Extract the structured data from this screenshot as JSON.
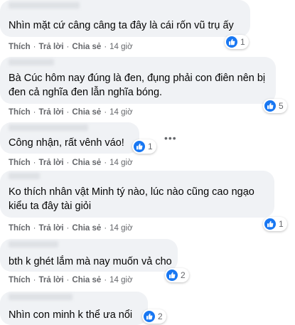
{
  "actions": {
    "like": "Thích",
    "reply": "Trả lời",
    "share": "Chia sẻ",
    "separator": "·"
  },
  "icons": {
    "like": "like-icon",
    "more": "more-options-icon"
  },
  "colors": {
    "like_blue": "#1877f2",
    "bubble": "#f0f2f5",
    "muted_text": "#65676b"
  },
  "comments": [
    {
      "text": "Nhìn mặt cứ câng câng ta đây là cái rốn vũ trụ ấy",
      "time": "14 giờ",
      "reactions": "1"
    },
    {
      "text": "Bà Cúc hôm nay đúng là đen, đụng phải con điên nên bị\nđen cả nghĩa đen lẫn nghĩa bóng.",
      "time": "14 giờ",
      "reactions": "5"
    },
    {
      "text": "Công nhận, rất vênh váo!",
      "time": "14 giờ",
      "reactions": "1"
    },
    {
      "text": "Ko thích nhân vật Minh tý nào, lúc nào cũng cao ngạo\nkiểu ta đây tài giỏi",
      "time": "14 giờ",
      "reactions": "1"
    },
    {
      "text": "bth k ghét lắm mà nay muốn vả cho",
      "time": "14 giờ",
      "reactions": "2"
    },
    {
      "text": "Nhìn con minh k thể ưa nổi",
      "time": "",
      "reactions": "2"
    }
  ]
}
